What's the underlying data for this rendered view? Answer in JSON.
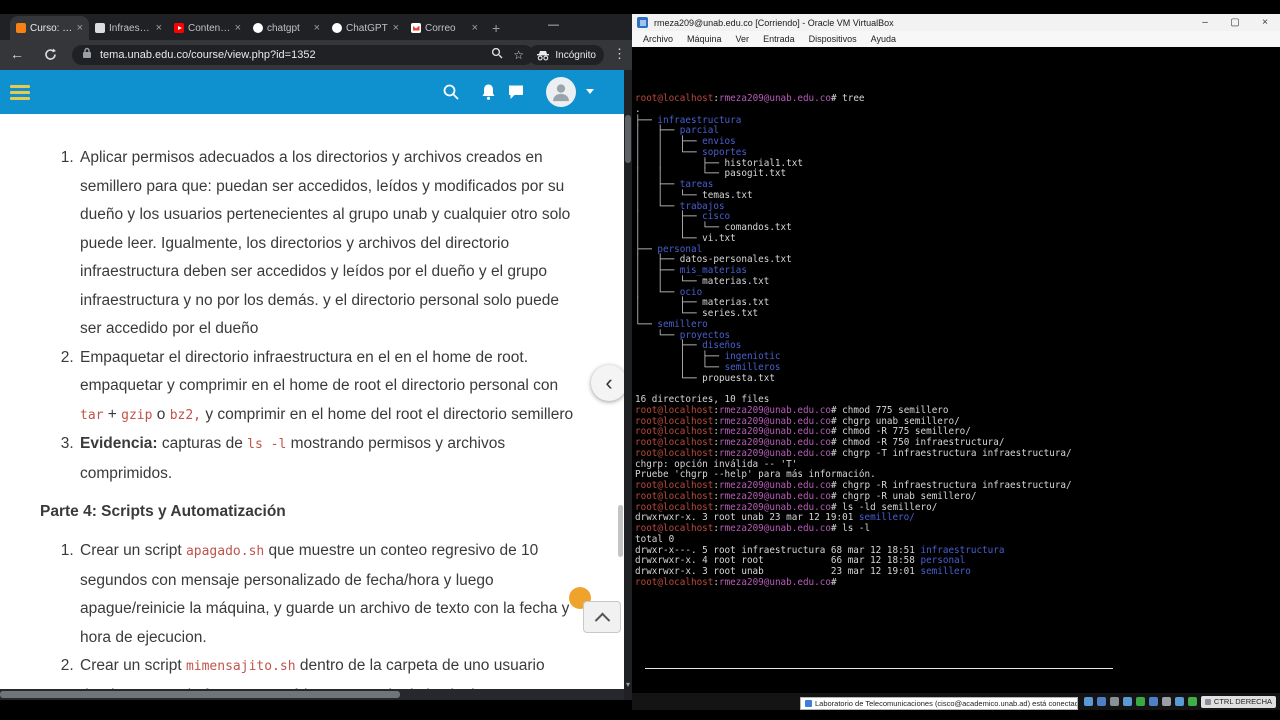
{
  "theme": {
    "accent": "#0f90cf",
    "code": "#bf544b",
    "dir_blue": "#4a5fd0",
    "prompt_red": "#bb4a3c",
    "prompt_magenta": "#b85cb8"
  },
  "icons": {
    "close": "×",
    "newtab": "+",
    "back": "←",
    "menu_dots": "⋮",
    "star": "☆",
    "minimize": "—",
    "window_min": "–",
    "window_max": "▢",
    "window_close": "×",
    "vdown": "▾",
    "chevron_left": "‹"
  },
  "browser": {
    "tabs": [
      {
        "label": "Curso: Infraestructura"
      },
      {
        "label": "Infraestructura"
      },
      {
        "label": "Contenido"
      },
      {
        "label": "chatgpt"
      },
      {
        "label": "ChatGPT"
      },
      {
        "label": "Correo"
      }
    ],
    "url": "tema.unab.edu.co/course/view.php?id=1352",
    "incognito_label": "Incógnito"
  },
  "doc": {
    "list1": [
      {
        "segs": [
          {
            "t": "Aplicar permisos adecuados a los directorios y archivos creados en semillero para que: puedan ser accedidos, leídos y modificados por su dueño y los usuarios pertenecientes al grupo unab y cualquier otro solo puede leer. Igualmente, los directorios y archivos del directorio infraestructura deben ser accedidos y leídos por el dueño y el grupo infraestructura y no por los demás. y el directorio personal solo puede ser accedido por el dueño"
          }
        ]
      },
      {
        "segs": [
          {
            "t": "Empaquetar el directorio infraestructura en el en el home de root. empaquetar y comprimir en el home de root el directorio personal con "
          },
          {
            "t": "tar",
            "s": "code"
          },
          {
            "t": " + "
          },
          {
            "t": "gzip",
            "s": "code"
          },
          {
            "t": " o "
          },
          {
            "t": "bz2,",
            "s": "code"
          },
          {
            "t": " y comprimir en el home del root el directorio semillero"
          }
        ]
      },
      {
        "segs": [
          {
            "t": "Evidencia:",
            "s": "bold"
          },
          {
            "t": " capturas de "
          },
          {
            "t": "ls -l",
            "s": "code"
          },
          {
            "t": " mostrando permisos y archivos comprimidos."
          }
        ]
      }
    ],
    "heading": "Parte 4: Scripts y Automatización",
    "list2": [
      {
        "segs": [
          {
            "t": "Crear un script "
          },
          {
            "t": "apagado.sh",
            "s": "code"
          },
          {
            "t": " que muestre un conteo regresivo de 10 segundos con mensaje personalizado de fecha/hora y luego apague/reinicie la máquina, y guarde un archivo de texto con la fecha y hora de ejecucion."
          }
        ]
      },
      {
        "segs": [
          {
            "t": "Crear un script "
          },
          {
            "t": "mimensajito.sh",
            "s": "code"
          },
          {
            "t": " dentro de la carpeta de uno usuario donde se cree de forma automática un usuario de la siguiente manera:"
          }
        ]
      }
    ]
  },
  "vbox": {
    "title": "rmeza209@unab.edu.co [Corriendo] - Oracle VM VirtualBox",
    "menus": [
      "Archivo",
      "Máquina",
      "Ver",
      "Entrada",
      "Dispositivos",
      "Ayuda"
    ],
    "host_key": "CTRL DERECHA",
    "notification": "Laboratorio de Telecomunicaciones (cisco@academico.unab.ad) está conectado",
    "terminal": {
      "lines": [
        [
          {
            "t": "root@localhost",
            "s": "p1"
          },
          {
            "t": ":"
          },
          {
            "t": "rmeza209@unab.edu.co",
            "s": "p2"
          },
          {
            "t": "# "
          },
          {
            "t": "tree"
          }
        ],
        [
          {
            "t": "."
          }
        ],
        [
          {
            "t": "├── "
          },
          {
            "t": "infraestructura",
            "s": "dir"
          }
        ],
        [
          {
            "t": "│   ├── "
          },
          {
            "t": "parcial",
            "s": "dir"
          }
        ],
        [
          {
            "t": "│   │   ├── "
          },
          {
            "t": "envios",
            "s": "dir"
          }
        ],
        [
          {
            "t": "│   │   └── "
          },
          {
            "t": "soportes",
            "s": "dir"
          }
        ],
        [
          {
            "t": "│   │       ├── historial1.txt"
          }
        ],
        [
          {
            "t": "│   │       └── pasogit.txt"
          }
        ],
        [
          {
            "t": "│   ├── "
          },
          {
            "t": "tareas",
            "s": "dir"
          }
        ],
        [
          {
            "t": "│   │   └── temas.txt"
          }
        ],
        [
          {
            "t": "│   └── "
          },
          {
            "t": "trabajos",
            "s": "dir"
          }
        ],
        [
          {
            "t": "│       ├── "
          },
          {
            "t": "cisco",
            "s": "dir"
          }
        ],
        [
          {
            "t": "│       │   └── comandos.txt"
          }
        ],
        [
          {
            "t": "│       └── vi.txt"
          }
        ],
        [
          {
            "t": "├── "
          },
          {
            "t": "personal",
            "s": "dir"
          }
        ],
        [
          {
            "t": "│   ├── datos-personales.txt"
          }
        ],
        [
          {
            "t": "│   ├── "
          },
          {
            "t": "mis_materias",
            "s": "dir"
          }
        ],
        [
          {
            "t": "│   │   └── materias.txt"
          }
        ],
        [
          {
            "t": "│   └── "
          },
          {
            "t": "ocio",
            "s": "dir"
          }
        ],
        [
          {
            "t": "│       ├── materias.txt"
          }
        ],
        [
          {
            "t": "│       └── series.txt"
          }
        ],
        [
          {
            "t": "└── "
          },
          {
            "t": "semillero",
            "s": "dir"
          }
        ],
        [
          {
            "t": "    └── "
          },
          {
            "t": "proyectos",
            "s": "dir"
          }
        ],
        [
          {
            "t": "        ├── "
          },
          {
            "t": "diseños",
            "s": "dir"
          }
        ],
        [
          {
            "t": "        │   ├── "
          },
          {
            "t": "ingeniotic",
            "s": "dir"
          }
        ],
        [
          {
            "t": "        │   └── "
          },
          {
            "t": "semilleros",
            "s": "dir"
          }
        ],
        [
          {
            "t": "        └── propuesta.txt"
          }
        ],
        [
          {
            "t": " "
          }
        ],
        [
          {
            "t": "16 directories, 10 files"
          }
        ],
        [
          {
            "t": "root@localhost",
            "s": "p1"
          },
          {
            "t": ":"
          },
          {
            "t": "rmeza209@unab.edu.co",
            "s": "p2"
          },
          {
            "t": "# "
          },
          {
            "t": "chmod 775 semillero"
          }
        ],
        [
          {
            "t": "root@localhost",
            "s": "p1"
          },
          {
            "t": ":"
          },
          {
            "t": "rmeza209@unab.edu.co",
            "s": "p2"
          },
          {
            "t": "# "
          },
          {
            "t": "chgrp unab semillero/"
          }
        ],
        [
          {
            "t": "root@localhost",
            "s": "p1"
          },
          {
            "t": ":"
          },
          {
            "t": "rmeza209@unab.edu.co",
            "s": "p2"
          },
          {
            "t": "# "
          },
          {
            "t": "chmod -R 775 semillero/"
          }
        ],
        [
          {
            "t": "root@localhost",
            "s": "p1"
          },
          {
            "t": ":"
          },
          {
            "t": "rmeza209@unab.edu.co",
            "s": "p2"
          },
          {
            "t": "# "
          },
          {
            "t": "chmod -R 750 infraestructura/"
          }
        ],
        [
          {
            "t": "root@localhost",
            "s": "p1"
          },
          {
            "t": ":"
          },
          {
            "t": "rmeza209@unab.edu.co",
            "s": "p2"
          },
          {
            "t": "# "
          },
          {
            "t": "chgrp -T infraestructura infraestructura/"
          }
        ],
        [
          {
            "t": "chgrp: opción inválida -- 'T'"
          }
        ],
        [
          {
            "t": "Pruebe 'chgrp --help' para más información."
          }
        ],
        [
          {
            "t": "root@localhost",
            "s": "p1"
          },
          {
            "t": ":"
          },
          {
            "t": "rmeza209@unab.edu.co",
            "s": "p2"
          },
          {
            "t": "# "
          },
          {
            "t": "chgrp -R infraestructura infraestructura/"
          }
        ],
        [
          {
            "t": "root@localhost",
            "s": "p1"
          },
          {
            "t": ":"
          },
          {
            "t": "rmeza209@unab.edu.co",
            "s": "p2"
          },
          {
            "t": "# "
          },
          {
            "t": "chgrp -R unab semillero/"
          }
        ],
        [
          {
            "t": "root@localhost",
            "s": "p1"
          },
          {
            "t": ":"
          },
          {
            "t": "rmeza209@unab.edu.co",
            "s": "p2"
          },
          {
            "t": "# "
          },
          {
            "t": "ls -ld semillero/"
          }
        ],
        [
          {
            "t": "drwxrwxr-x. 3 root unab 23 mar 12 19:01 "
          },
          {
            "t": "semillero/",
            "s": "dir"
          }
        ],
        [
          {
            "t": "root@localhost",
            "s": "p1"
          },
          {
            "t": ":"
          },
          {
            "t": "rmeza209@unab.edu.co",
            "s": "p2"
          },
          {
            "t": "# "
          },
          {
            "t": "ls -l"
          }
        ],
        [
          {
            "t": "total 0"
          }
        ],
        [
          {
            "t": "drwxr-x---. 5 root infraestructura 68 mar 12 18:51 "
          },
          {
            "t": "infraestructura",
            "s": "dir"
          }
        ],
        [
          {
            "t": "drwxrwxr-x. 4 root root            66 mar 12 18:58 "
          },
          {
            "t": "personal",
            "s": "dir"
          }
        ],
        [
          {
            "t": "drwxrwxr-x. 3 root unab            23 mar 12 19:01 "
          },
          {
            "t": "semillero",
            "s": "dir"
          }
        ],
        [
          {
            "t": "root@localhost",
            "s": "p1"
          },
          {
            "t": ":"
          },
          {
            "t": "rmeza209@unab.edu.co",
            "s": "p2"
          },
          {
            "t": "#"
          }
        ]
      ]
    }
  }
}
